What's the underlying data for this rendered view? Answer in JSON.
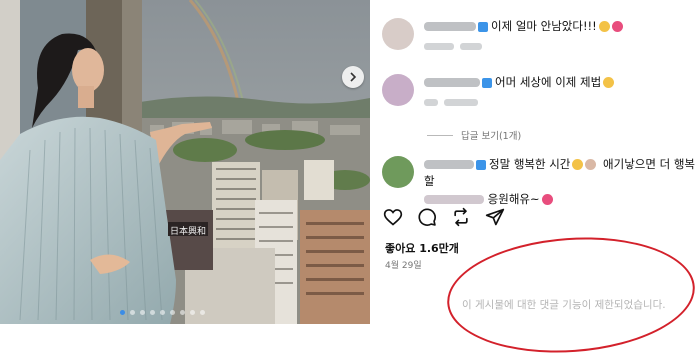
{
  "post": {
    "carousel": {
      "dot_count": 9,
      "active_index": 0
    },
    "overlay_sign": "日本興和"
  },
  "comments": [
    {
      "text": "이제 얼마 안남았다!!!",
      "emojis": [
        "hugging-face-emoji",
        "heart-emoji"
      ]
    },
    {
      "text": "어머 세상에 이제 제법",
      "emojis": [
        "hugging-face-emoji"
      ],
      "meta_blurred": true
    },
    {
      "text_line1": "정말 행복한 시간",
      "text_line1_b": "애기낳으면 더 행복할",
      "text_line2": "응원해유~",
      "emojis": [
        "hugging-face-emoji",
        "rabbit-emoji",
        "heart-emoji"
      ]
    }
  ],
  "replies": {
    "label": "답글 보기(1개)"
  },
  "actions": {
    "icons": [
      "heart-icon",
      "comment-icon",
      "repost-icon",
      "share-icon"
    ]
  },
  "likes": {
    "label": "좋아요 1.6만개"
  },
  "date": {
    "label": "4월 29일"
  },
  "comments_disabled": {
    "message": "이 게시물에 대한 댓글 기능이 제한되었습니다."
  },
  "colors": {
    "highlight_ring": "#d3212b",
    "verified_badge": "#3c94e8",
    "carousel_active": "#3b8de6"
  }
}
